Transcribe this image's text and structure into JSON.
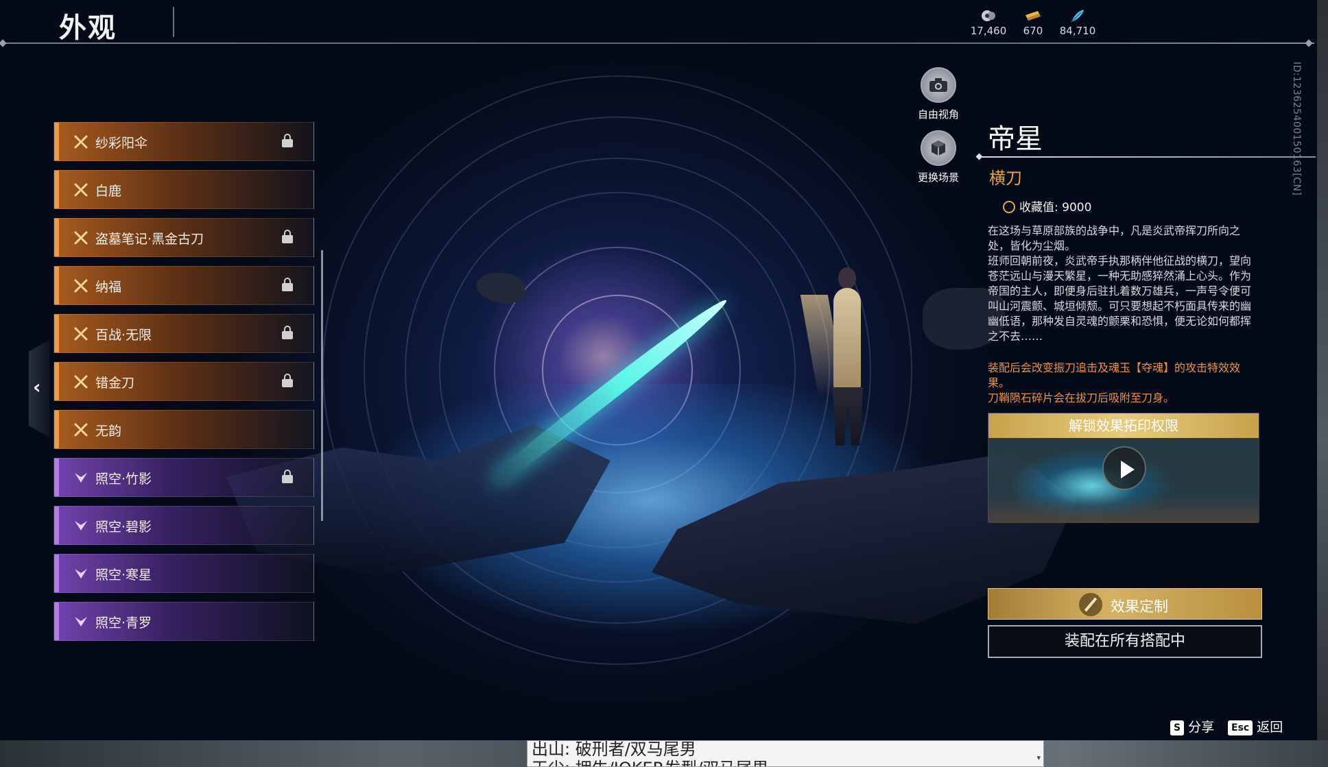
{
  "header": {
    "title": "外观",
    "currencies": [
      {
        "icon": "moon-token-icon",
        "value": "17,460",
        "color": "#c8ccd4"
      },
      {
        "icon": "gold-ticket-icon",
        "value": "670",
        "color": "#e8b84a"
      },
      {
        "icon": "feather-token-icon",
        "value": "84,710",
        "color": "#4cc6e8"
      }
    ],
    "player_id": "ID:1236254001501​63[CN]"
  },
  "skin_list": {
    "items": [
      {
        "name": "纱彩阳伞",
        "rarity": "orange",
        "locked": true
      },
      {
        "name": "白鹿",
        "rarity": "orange",
        "locked": false
      },
      {
        "name": "盗墓笔记·黑金古刀",
        "rarity": "orange",
        "locked": true
      },
      {
        "name": "纳福",
        "rarity": "orange",
        "locked": true
      },
      {
        "name": "百战·无限",
        "rarity": "orange",
        "locked": true
      },
      {
        "name": "错金刀",
        "rarity": "orange",
        "locked": true
      },
      {
        "name": "无韵",
        "rarity": "orange",
        "locked": false
      },
      {
        "name": "照空·竹影",
        "rarity": "purple",
        "locked": true
      },
      {
        "name": "照空·碧影",
        "rarity": "purple",
        "locked": false
      },
      {
        "name": "照空·寒星",
        "rarity": "purple",
        "locked": false
      },
      {
        "name": "照空·青罗",
        "rarity": "purple",
        "locked": false
      }
    ],
    "collapse_icon": "‹"
  },
  "view_buttons": {
    "free_camera": {
      "label": "自由视角",
      "icon": "camera-icon"
    },
    "change_scene": {
      "label": "更换场景",
      "icon": "scene-cube-icon"
    }
  },
  "detail": {
    "title": "帝星",
    "type": "横刀",
    "collect_label": "收藏值: 9000",
    "description": "在这场与草原部族的战争中，凡是炎武帝挥刀所向之处，皆化为尘烟。\n班师回朝前夜，炎武帝手执那柄伴他征战的横刀，望向苍茫远山与漫天繁星，一种无助感猝然涌上心头。作为帝国的主人，即便身后驻扎着数万雄兵，一声号令便可叫山河震颤、城垣倾颓。可只要想起不朽面具传来的幽幽低语，那种发自灵魂的颤栗和恐惧，便无论如何都挥之不去……",
    "effect_note": "装配后会改变振刀追击及魂玉【夺魂】的攻击特效效果。\n刀鞘陨石碎片会在拔刀后吸附至刀身。",
    "unlock_label": "解锁效果拓印权限",
    "accent_color": "#e9a13d"
  },
  "actions": {
    "customize_label": "效果定制",
    "equip_all_label": "装配在所有搭配中"
  },
  "hints": [
    {
      "key": "S",
      "label": "分享"
    },
    {
      "key": "Esc",
      "label": "返回"
    }
  ],
  "external_text": {
    "line1": "出山: 破刑者/双马尾男",
    "line2": "天尘: 拥牛/JOKER发型/双马尾男"
  }
}
